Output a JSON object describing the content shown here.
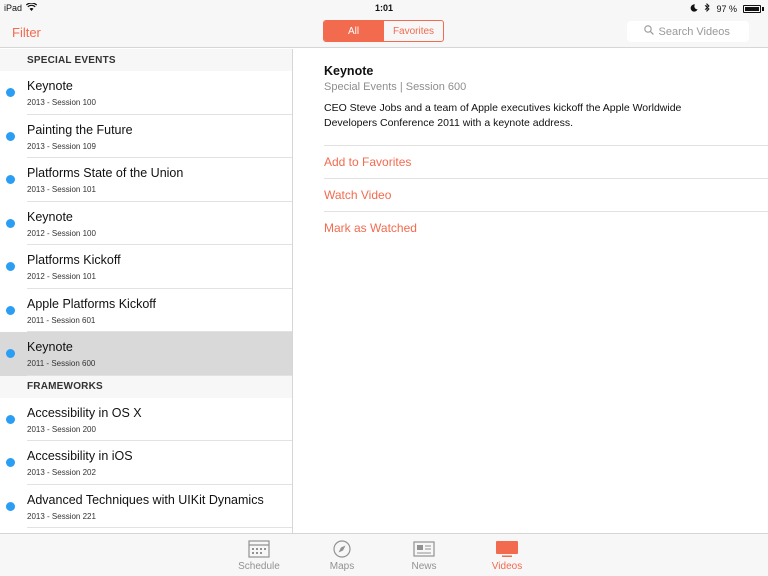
{
  "status_bar": {
    "device": "iPad",
    "time": "1:01",
    "battery": "97 %"
  },
  "nav": {
    "filter_label": "Filter",
    "segments": [
      {
        "label": "All",
        "active": true
      },
      {
        "label": "Favorites",
        "active": false
      }
    ],
    "search_placeholder": "Search Videos"
  },
  "sidebar": {
    "sections": [
      {
        "header": "SPECIAL EVENTS",
        "items": [
          {
            "title": "Keynote",
            "subtitle": "2013 - Session 100"
          },
          {
            "title": "Painting the Future",
            "subtitle": "2013 - Session 109"
          },
          {
            "title": "Platforms State of the Union",
            "subtitle": "2013 - Session 101"
          },
          {
            "title": "Keynote",
            "subtitle": "2012 - Session 100"
          },
          {
            "title": "Platforms Kickoff",
            "subtitle": "2012 - Session 101"
          },
          {
            "title": "Apple Platforms Kickoff",
            "subtitle": "2011 - Session 601"
          },
          {
            "title": "Keynote",
            "subtitle": "2011 - Session 600",
            "selected": true
          }
        ]
      },
      {
        "header": "FRAMEWORKS",
        "items": [
          {
            "title": "Accessibility in OS X",
            "subtitle": "2013 - Session 200"
          },
          {
            "title": "Accessibility in iOS",
            "subtitle": "2013 - Session 202"
          },
          {
            "title": "Advanced Techniques with UIKit Dynamics",
            "subtitle": "2013 - Session 221"
          }
        ]
      }
    ]
  },
  "detail": {
    "title": "Keynote",
    "meta": "Special Events | Session 600",
    "description": "CEO Steve Jobs and a team of Apple executives kickoff the Apple Worldwide Developers Conference 2011 with a keynote address.",
    "actions": [
      "Add to Favorites",
      "Watch Video",
      "Mark as Watched"
    ]
  },
  "tabs": [
    {
      "label": "Schedule",
      "icon": "calendar-icon",
      "active": false
    },
    {
      "label": "Maps",
      "icon": "compass-icon",
      "active": false
    },
    {
      "label": "News",
      "icon": "newspaper-icon",
      "active": false
    },
    {
      "label": "Videos",
      "icon": "tv-icon",
      "active": true
    }
  ],
  "colors": {
    "accent": "#f26b4f",
    "unwatched_dot": "#2a9df4",
    "selected_row": "#d9d9d9"
  }
}
